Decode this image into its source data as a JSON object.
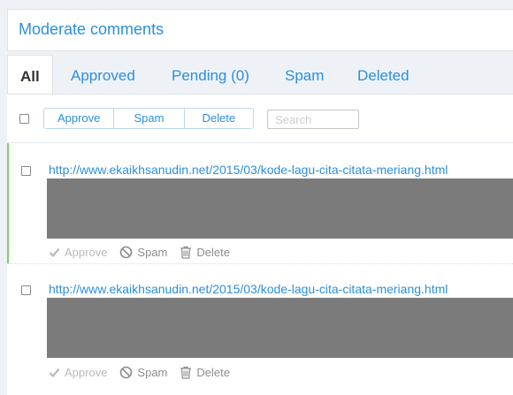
{
  "header": {
    "title": "Moderate comments"
  },
  "tabs": [
    {
      "label": "All"
    },
    {
      "label": "Approved"
    },
    {
      "label": "Pending (0)"
    },
    {
      "label": "Spam"
    },
    {
      "label": "Deleted"
    }
  ],
  "toolbar": {
    "approve_label": "Approve",
    "spam_label": "Spam",
    "delete_label": "Delete",
    "search_placeholder": "Search"
  },
  "comments": [
    {
      "link": "http://www.ekaikhsanudin.net/2015/03/kode-lagu-cita-citata-meriang.html",
      "actions": {
        "approve": "Approve",
        "spam": "Spam",
        "delete": "Delete"
      }
    },
    {
      "link": "http://www.ekaikhsanudin.net/2015/03/kode-lagu-cita-citata-meriang.html",
      "actions": {
        "approve": "Approve",
        "spam": "Spam",
        "delete": "Delete"
      }
    }
  ],
  "colors": {
    "accent": "#2a8fe0",
    "bar": "#7ccf6b",
    "redacted": "#7b7b7b"
  },
  "icons": [
    "check-icon",
    "spam-icon",
    "trash-icon"
  ]
}
